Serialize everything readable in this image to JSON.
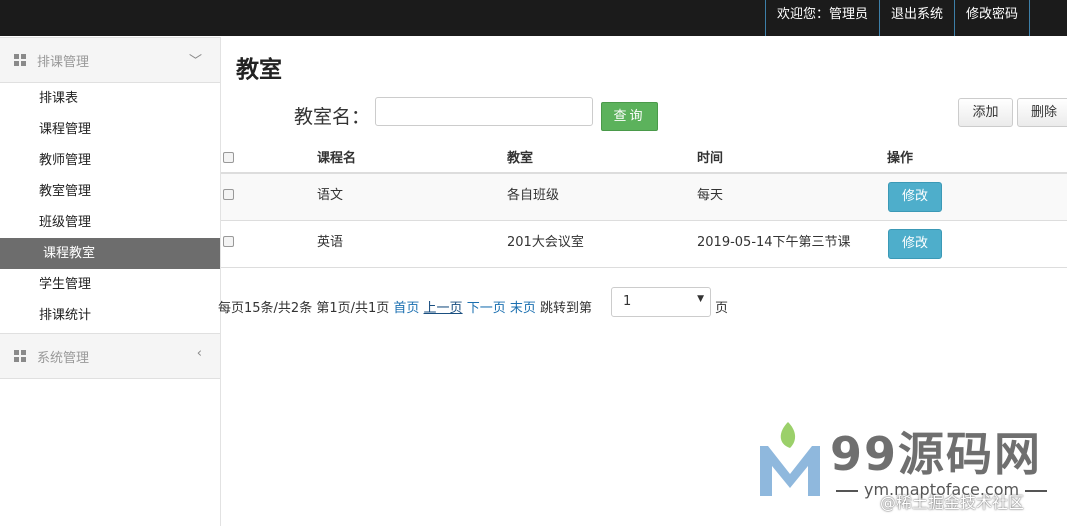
{
  "topnav": {
    "welcome": "欢迎您：管理员",
    "logout": "退出系统",
    "change_password": "修改密码"
  },
  "sidebar": {
    "group1": {
      "title": "排课管理",
      "arrow": "﹀"
    },
    "items": [
      {
        "label": "排课表"
      },
      {
        "label": "课程管理"
      },
      {
        "label": "教师管理"
      },
      {
        "label": "教室管理"
      },
      {
        "label": "班级管理"
      },
      {
        "label": "课程教室",
        "active": true
      },
      {
        "label": "学生管理"
      },
      {
        "label": "排课统计"
      }
    ],
    "group2": {
      "title": "系统管理",
      "arrow": "‹"
    }
  },
  "main": {
    "title": "教室",
    "search_label": "教室名：",
    "search_value": "",
    "search_button": "查询",
    "add_button": "添加",
    "delete_button": "删除"
  },
  "table": {
    "headers": [
      "课程名",
      "教室",
      "时间",
      "操作"
    ],
    "rows": [
      {
        "course": "语文",
        "room": "各自班级",
        "time": "每天",
        "action": "修改"
      },
      {
        "course": "英语",
        "room": "201大会议室",
        "time": "2019-05-14下午第三节课",
        "action": "修改"
      }
    ]
  },
  "pager": {
    "summary": "每页15条/共2条 第1页/共1页",
    "first": "首页",
    "prev": "上一页",
    "next": "下一页",
    "last": "末页",
    "jump_label": "跳转到第",
    "selected_page": "1",
    "unit": "页"
  },
  "watermark": {
    "brand": "99源码网",
    "url": "ym.maptoface.com",
    "overlay": "@稀土掘金技术社区"
  }
}
